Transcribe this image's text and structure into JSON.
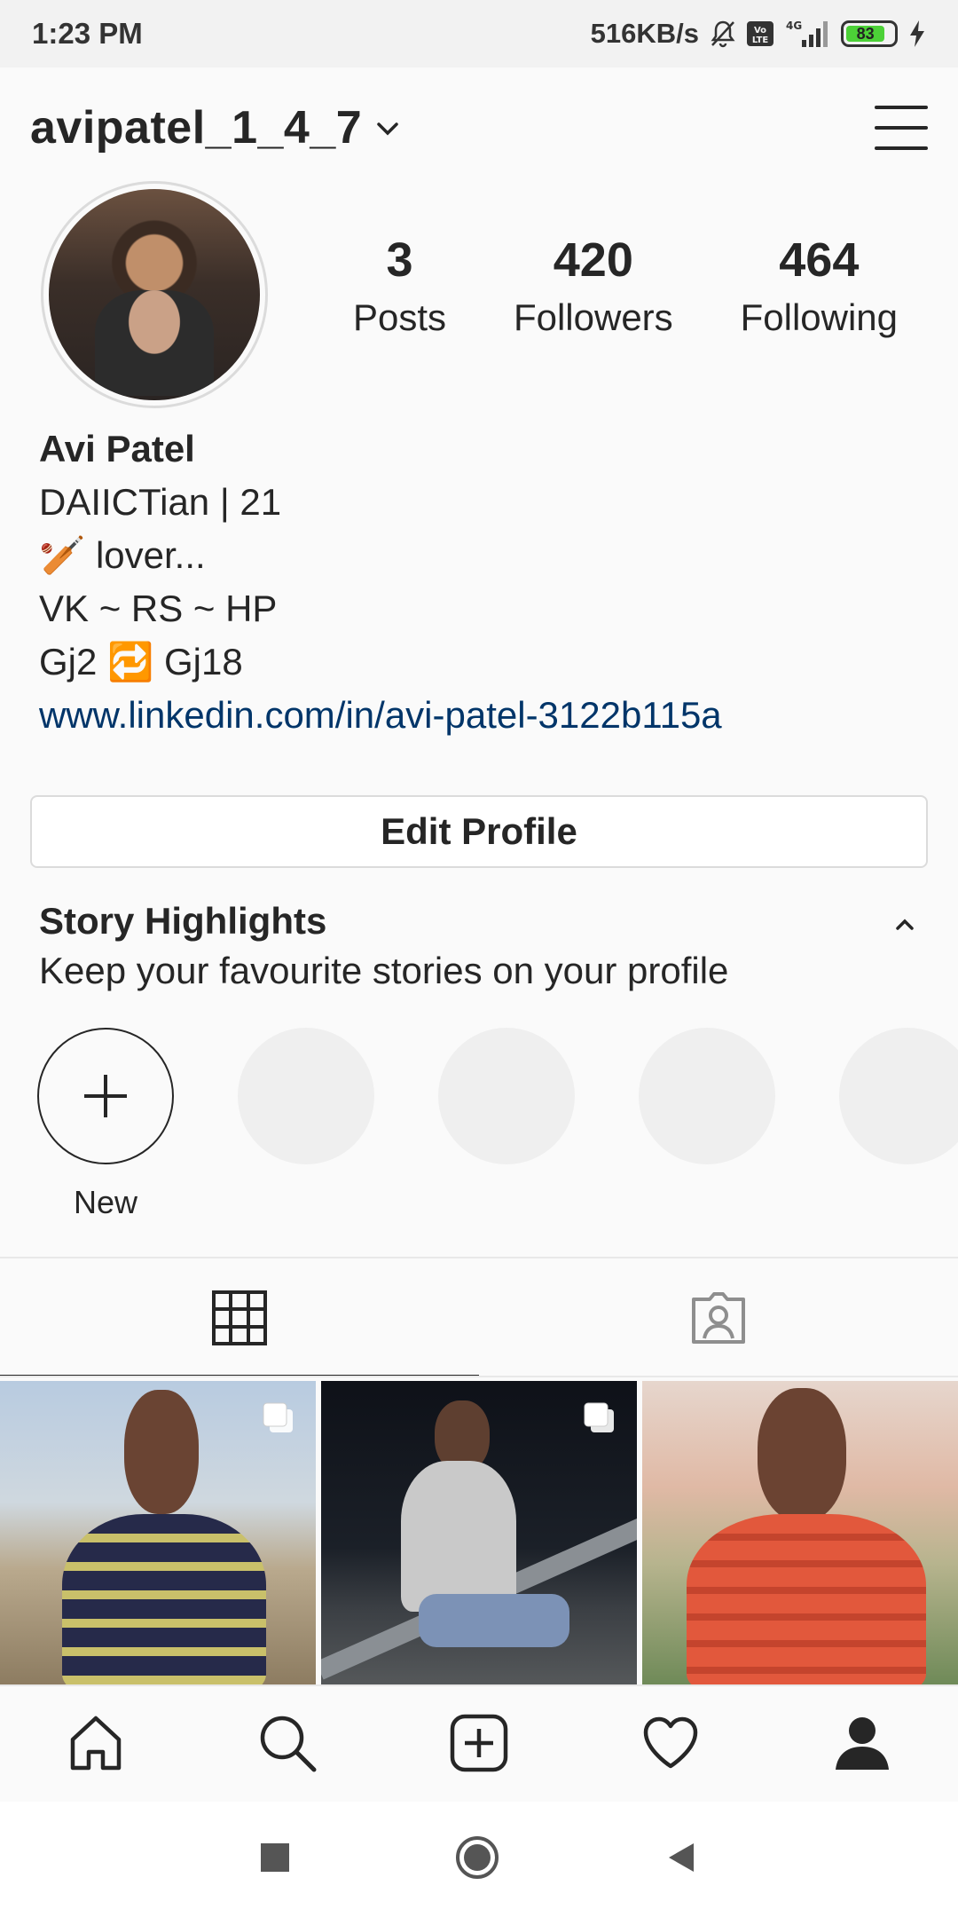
{
  "status_bar": {
    "time": "1:23 PM",
    "speed": "516KB/s",
    "volte": "Vo LTE",
    "network": "4G",
    "battery": "83"
  },
  "header": {
    "username": "avipatel_1_4_7"
  },
  "profile": {
    "stats": [
      {
        "value": "3",
        "label": "Posts"
      },
      {
        "value": "420",
        "label": "Followers"
      },
      {
        "value": "464",
        "label": "Following"
      }
    ],
    "name": "Avi Patel",
    "bio_lines": [
      "DAIICTian | 21",
      "🏏 lover...",
      "VK ~ RS ~ HP",
      "Gj2 🔁 Gj18"
    ],
    "link": "www.linkedin.com/in/avi-patel-3122b115a",
    "edit_button": "Edit Profile"
  },
  "highlights": {
    "title": "Story Highlights",
    "subtitle": "Keep your favourite stories on your profile",
    "new_label": "New"
  },
  "colors": {
    "link": "#003569",
    "text": "#262626",
    "border": "#dbdbdb"
  }
}
